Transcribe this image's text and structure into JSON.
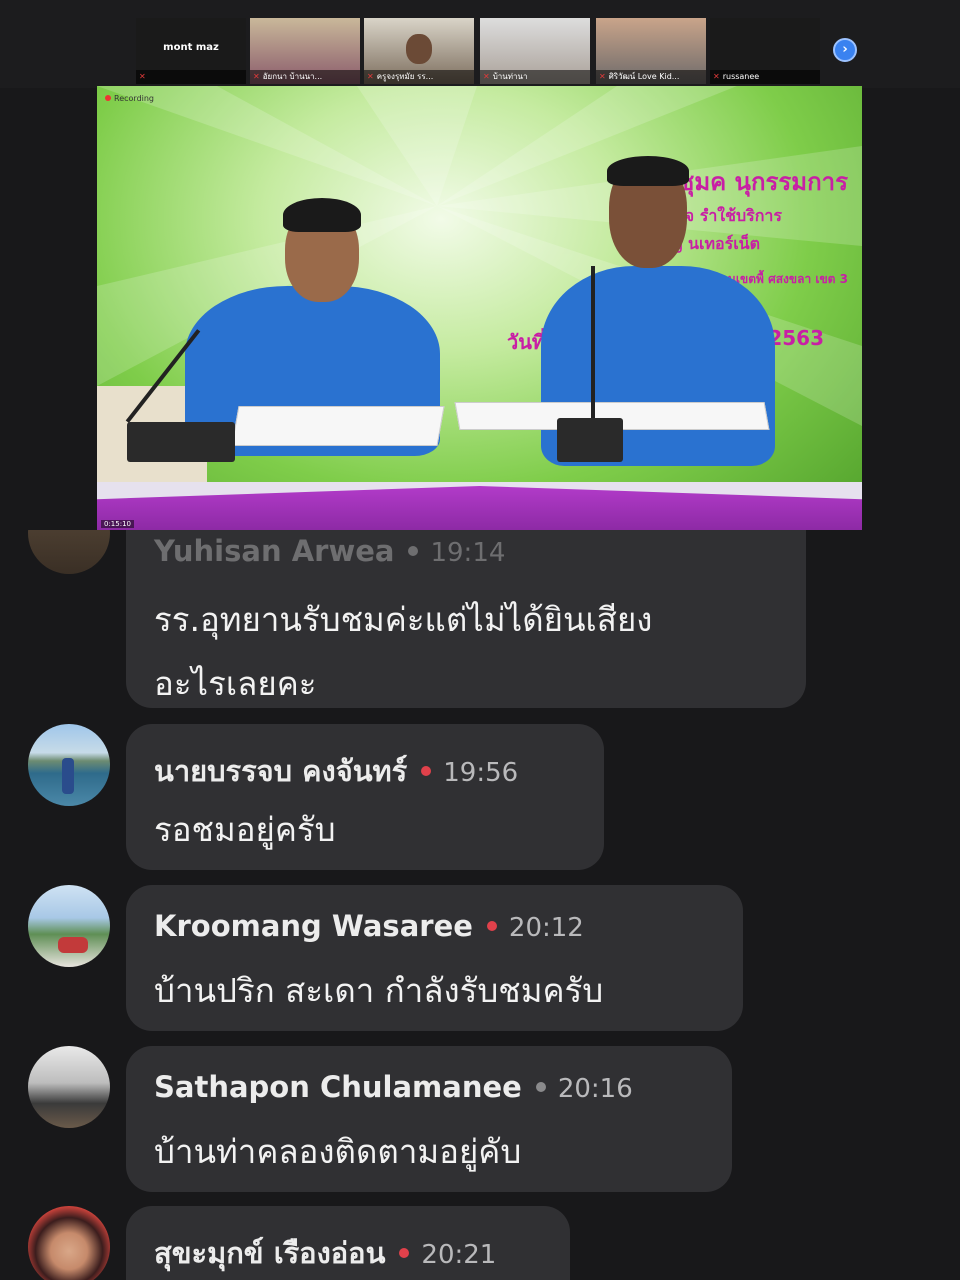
{
  "participants": [
    {
      "name": "mont maz"
    },
    {
      "name": "อัยกนา บ้านนา..."
    },
    {
      "name": "ครูจงรุทมัย รร..."
    },
    {
      "name": "บ้านท่านา"
    },
    {
      "name": "ศิริวัฒน์ Love Kid..."
    },
    {
      "name": "russanee"
    }
  ],
  "next_page_glyph": "›",
  "video": {
    "recording_label": "Recording",
    "banner_line1": "ประชุมค    นุกรรมการ",
    "banner_line2": "ตรวจ     รำใช้บริการ",
    "banner_line3": "สัญญ    นเทอร์เน็ต",
    "banner_line4": "สำนักงานเขตพื้               ศสงขลา  เขต 3",
    "banner_date_left": "วันที่",
    "banner_date_right": "2563",
    "status_text": "0:15:10"
  },
  "comments": [
    {
      "name": "Yuhisan Arwea",
      "time": "19:14",
      "lines": [
        "รร.อุทยานรับชมค่ะแต่ไม่ได้ยินเสียง",
        "อะไรเลยคะ"
      ],
      "dot_color": "#8a8a8c"
    },
    {
      "name": "นายบรรจบ คงจันทร์",
      "time": "19:56",
      "lines": [
        "รอชมอยู่ครับ"
      ],
      "dot_color": "#e0414b"
    },
    {
      "name": "Kroomang Wasaree",
      "time": "20:12",
      "lines": [
        "บ้านปริก สะเดา กำลังรับชมครับ"
      ],
      "dot_color": "#e0414b"
    },
    {
      "name": "Sathapon Chulamanee",
      "time": "20:16",
      "lines": [
        "บ้านท่าคลองติดตามอยู่คับ"
      ],
      "dot_color": "#8a8a8c"
    },
    {
      "name": "สุขะมุกข์ เรืองอ่อน",
      "time": "20:21",
      "lines": [],
      "dot_color": "#e0414b"
    }
  ]
}
